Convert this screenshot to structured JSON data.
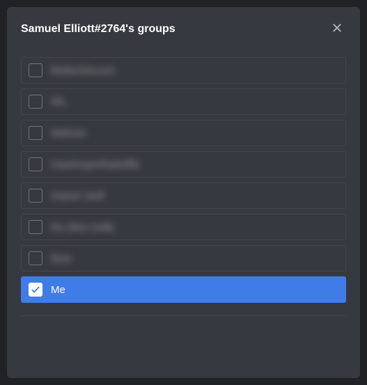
{
  "modal": {
    "title": "Samuel Elliott#2764's groups"
  },
  "groups": [
    {
      "label": "BetterDiscord",
      "checked": false,
      "blurred": true
    },
    {
      "label": "IRL",
      "checked": false,
      "blurred": true
    },
    {
      "label": "Wahuts",
      "checked": false,
      "blurred": true
    },
    {
      "label": "Harehope/Radcliffe",
      "checked": false,
      "blurred": true
    },
    {
      "label": "Airport stuff",
      "checked": false,
      "blurred": true
    },
    {
      "label": "No idea really",
      "checked": false,
      "blurred": true
    },
    {
      "label": "Bots",
      "checked": false,
      "blurred": true
    },
    {
      "label": "Me",
      "checked": true,
      "blurred": false
    }
  ],
  "colors": {
    "accent": "#3f7ce8",
    "background": "#36393f",
    "border": "#42454a"
  }
}
